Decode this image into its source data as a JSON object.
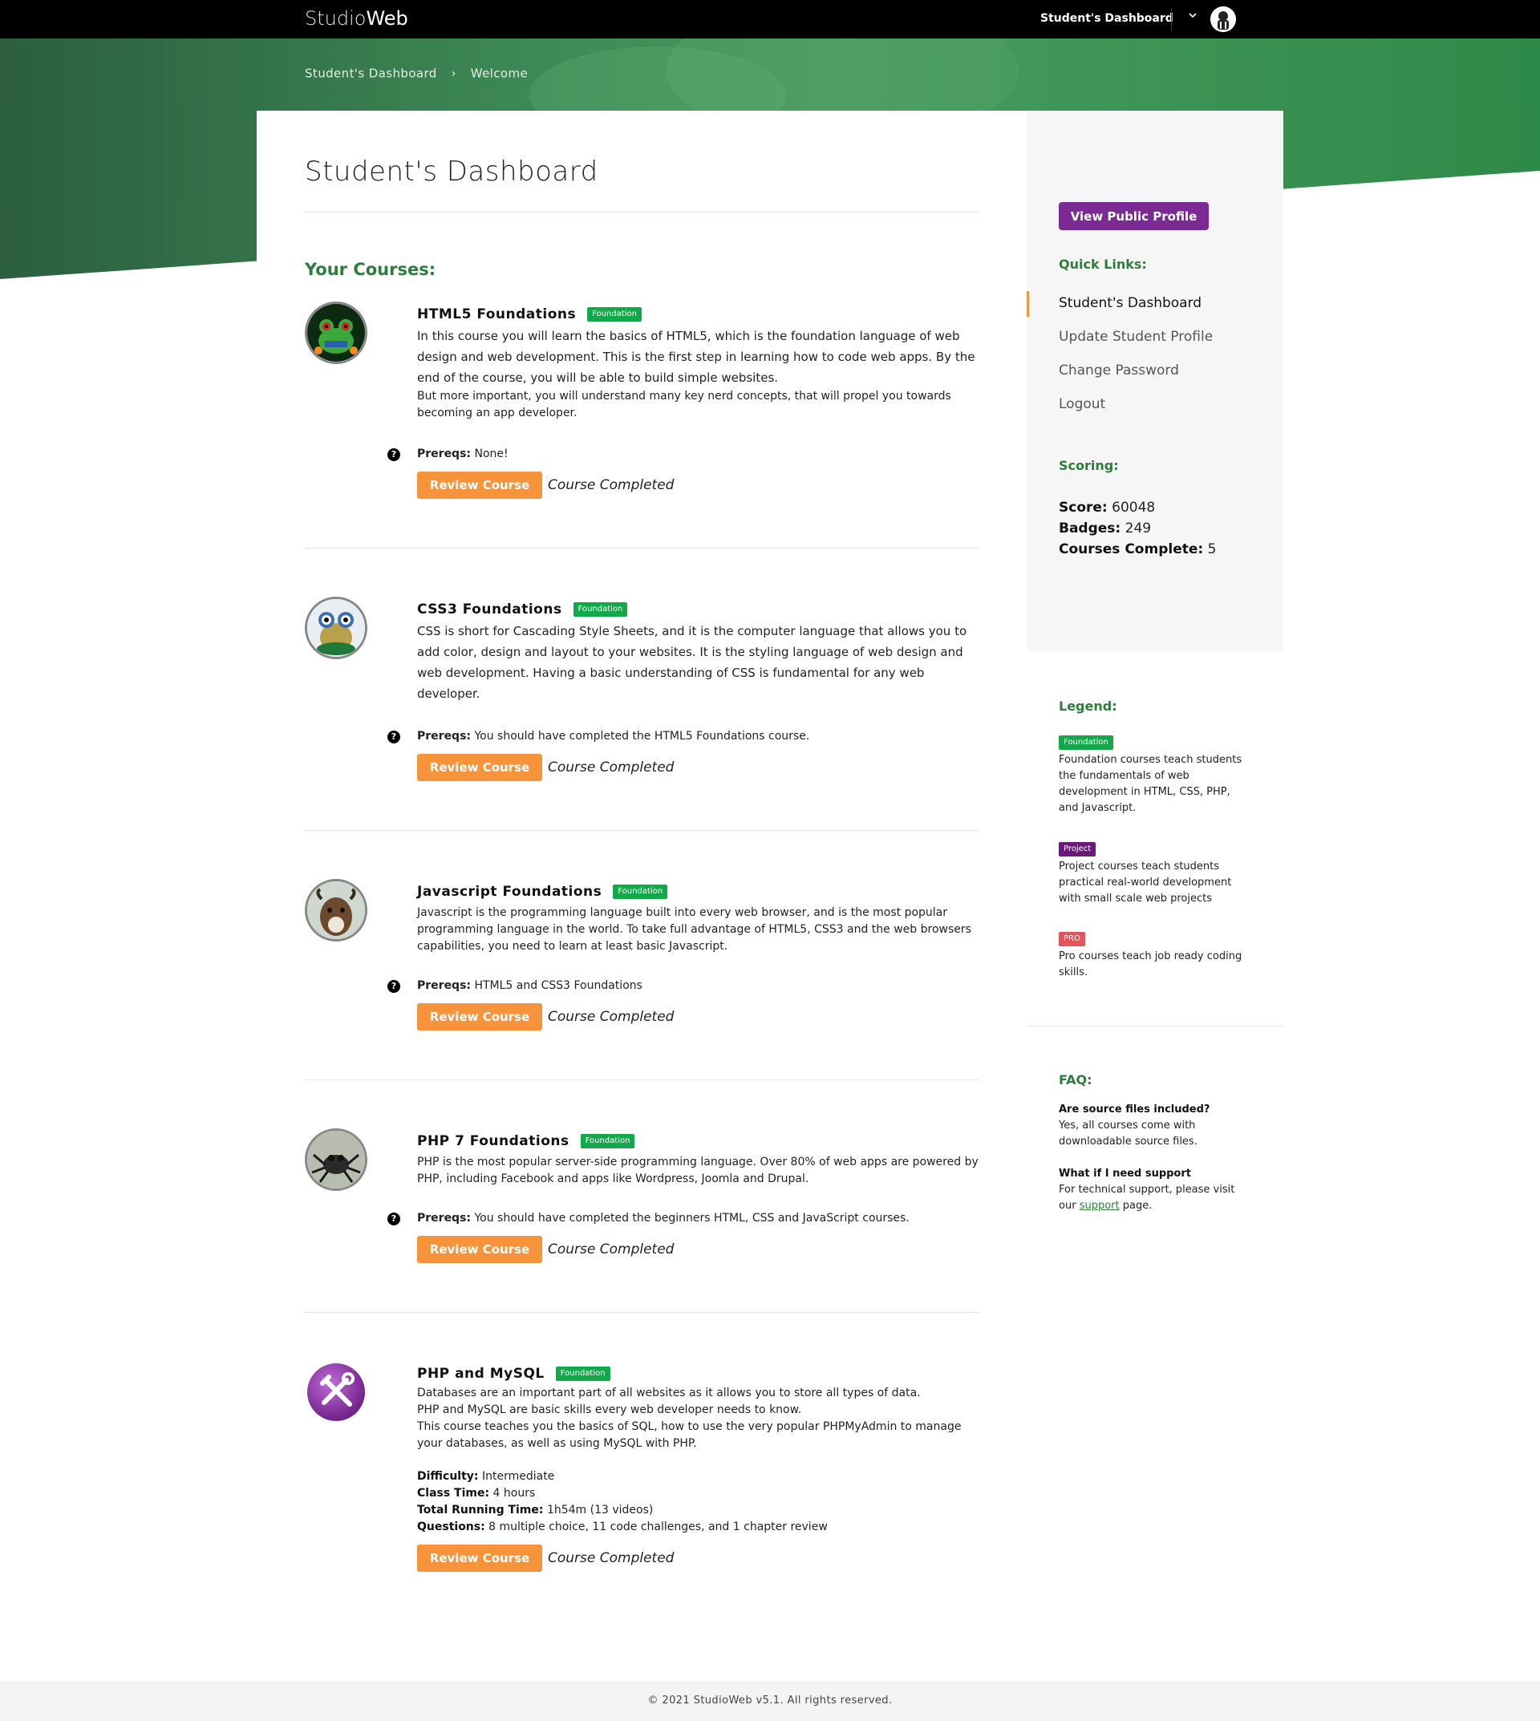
{
  "topbar": {
    "logo_light": "Studio",
    "logo_bold": "Web",
    "nav_link": "Student's Dashboard",
    "chevron": "⌄"
  },
  "breadcrumb": {
    "items": [
      "Student's Dashboard",
      "Welcome"
    ],
    "separator": "›"
  },
  "page": {
    "title": "Student's Dashboard",
    "courses_heading": "Your Courses:"
  },
  "courses": [
    {
      "title": "HTML5 Foundations",
      "badge": "Foundation",
      "desc_main": "In this course you will learn the basics of HTML5, which is the foundation language of web design and web development. This is the first step in learning how to code web apps. By the end of the course, you will be able to build simple websites.",
      "desc_extra": "But more important, you will understand many key nerd concepts, that will propel you towards becoming an app developer.",
      "prereq_label": "Prereqs:",
      "prereq_value": "None!",
      "button": "Review Course",
      "status": "Course Completed"
    },
    {
      "title": "CSS3 Foundations",
      "badge": "Foundation",
      "desc_main": "CSS is short for Cascading Style Sheets, and it is the computer language that allows you to add color, design and layout to your websites. It is the styling language of web design and web development. Having a basic understanding of CSS is fundamental for any web developer.",
      "prereq_label": "Prereqs:",
      "prereq_value": "You should have completed the HTML5 Foundations course.",
      "button": "Review Course",
      "status": "Course Completed"
    },
    {
      "title": "Javascript Foundations",
      "badge": "Foundation",
      "desc_main": "Javascript is the programming language built into every web browser, and is the most popular programming language in the world. To take full advantage of HTML5, CSS3 and the web browsers capabilities, you need to learn at least basic Javascript.",
      "prereq_label": "Prereqs:",
      "prereq_value": "HTML5 and CSS3 Foundations",
      "button": "Review Course",
      "status": "Course Completed"
    },
    {
      "title": "PHP 7 Foundations",
      "badge": "Foundation",
      "desc_main": "PHP is the most popular server-side programming language. Over 80% of web apps are powered by PHP, including Facebook and apps like Wordpress, Joomla and Drupal.",
      "prereq_label": "Prereqs:",
      "prereq_value": "You should have completed the beginners HTML, CSS and JavaScript courses.",
      "button": "Review Course",
      "status": "Course Completed"
    },
    {
      "title": "PHP and MySQL",
      "badge": "Foundation",
      "desc_lines": [
        "Databases are an important part of all websites as it allows you to store all types of data.",
        "PHP and MySQL are basic skills every web developer needs to know.",
        "This course teaches you the basics of SQL, how to use the very popular PHPMyAdmin to manage your databases, as well as using MySQL with PHP."
      ],
      "meta": [
        {
          "label": "Difficulty:",
          "value": "Intermediate"
        },
        {
          "label": "Class Time:",
          "value": "4 hours"
        },
        {
          "label": "Total Running Time:",
          "value": "1h54m (13 videos)"
        },
        {
          "label": "Questions:",
          "value": "8 multiple choice, 11 code challenges, and 1 chapter review"
        }
      ],
      "button": "Review Course",
      "status": "Course Completed"
    }
  ],
  "sidebar": {
    "profile_button": "View Public Profile",
    "quick_links_heading": "Quick Links:",
    "links": [
      "Student's Dashboard",
      "Update Student Profile",
      "Change Password",
      "Logout"
    ],
    "scoring_heading": "Scoring:",
    "score_label": "Score:",
    "score_value": "60048",
    "badges_label": "Badges:",
    "badges_value": "249",
    "courses_label": "Courses Complete:",
    "courses_value": "5",
    "legend_heading": "Legend:",
    "legend": [
      {
        "badge": "Foundation",
        "text": "Foundation courses teach students the fundamentals of web development in HTML, CSS, PHP, and Javascript."
      },
      {
        "badge": "Project",
        "text": "Project courses teach students practical real-world development with small scale web projects"
      },
      {
        "badge": "PRO",
        "text": "Pro courses teach job ready coding skills."
      }
    ],
    "faq_heading": "FAQ:",
    "faq": [
      {
        "q": "Are source files included?",
        "a": "Yes, all courses come with downloadable source files."
      },
      {
        "q": "What if I need support",
        "a_before": "For technical support, please visit our",
        "a_link": "support",
        "a_after": "page."
      }
    ]
  },
  "footer": {
    "text": "© 2021 StudioWeb v5.1. All rights reserved."
  },
  "colors": {
    "accent_green": "#2e7d3a",
    "hero_green": "#2f7a45",
    "orange": "#f7933a",
    "purple": "#7b2a93",
    "foundation_badge": "#13a84a",
    "project_badge": "#6a1b7a",
    "pro_badge": "#e0565b"
  },
  "icons": [
    "chevron-down-icon",
    "avatar-icon",
    "question-icon",
    "frog-thumbnail",
    "goat-thumbnail",
    "spider-thumbnail",
    "tools-icon"
  ]
}
